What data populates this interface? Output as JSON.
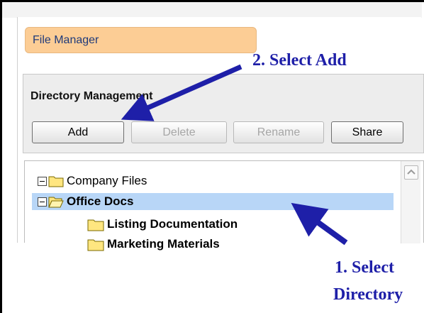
{
  "tab": {
    "label": "File Manager"
  },
  "directory_management": {
    "title": "Directory Management",
    "buttons": {
      "add": "Add",
      "delete": "Delete",
      "rename": "Rename",
      "share": "Share"
    }
  },
  "tree": {
    "root": "Company Files",
    "selected": "Office Docs",
    "children": [
      "Listing Documentation",
      "Marketing Materials"
    ]
  },
  "annotations": {
    "step2": "2. Select Add",
    "step1_line1": "1. Select",
    "step1_line2": "Directory"
  },
  "colors": {
    "tab_bg": "#fccd95",
    "selection_bg": "#b8d6f7",
    "annotation": "#1e1fa8",
    "folder": "#ffe680"
  }
}
